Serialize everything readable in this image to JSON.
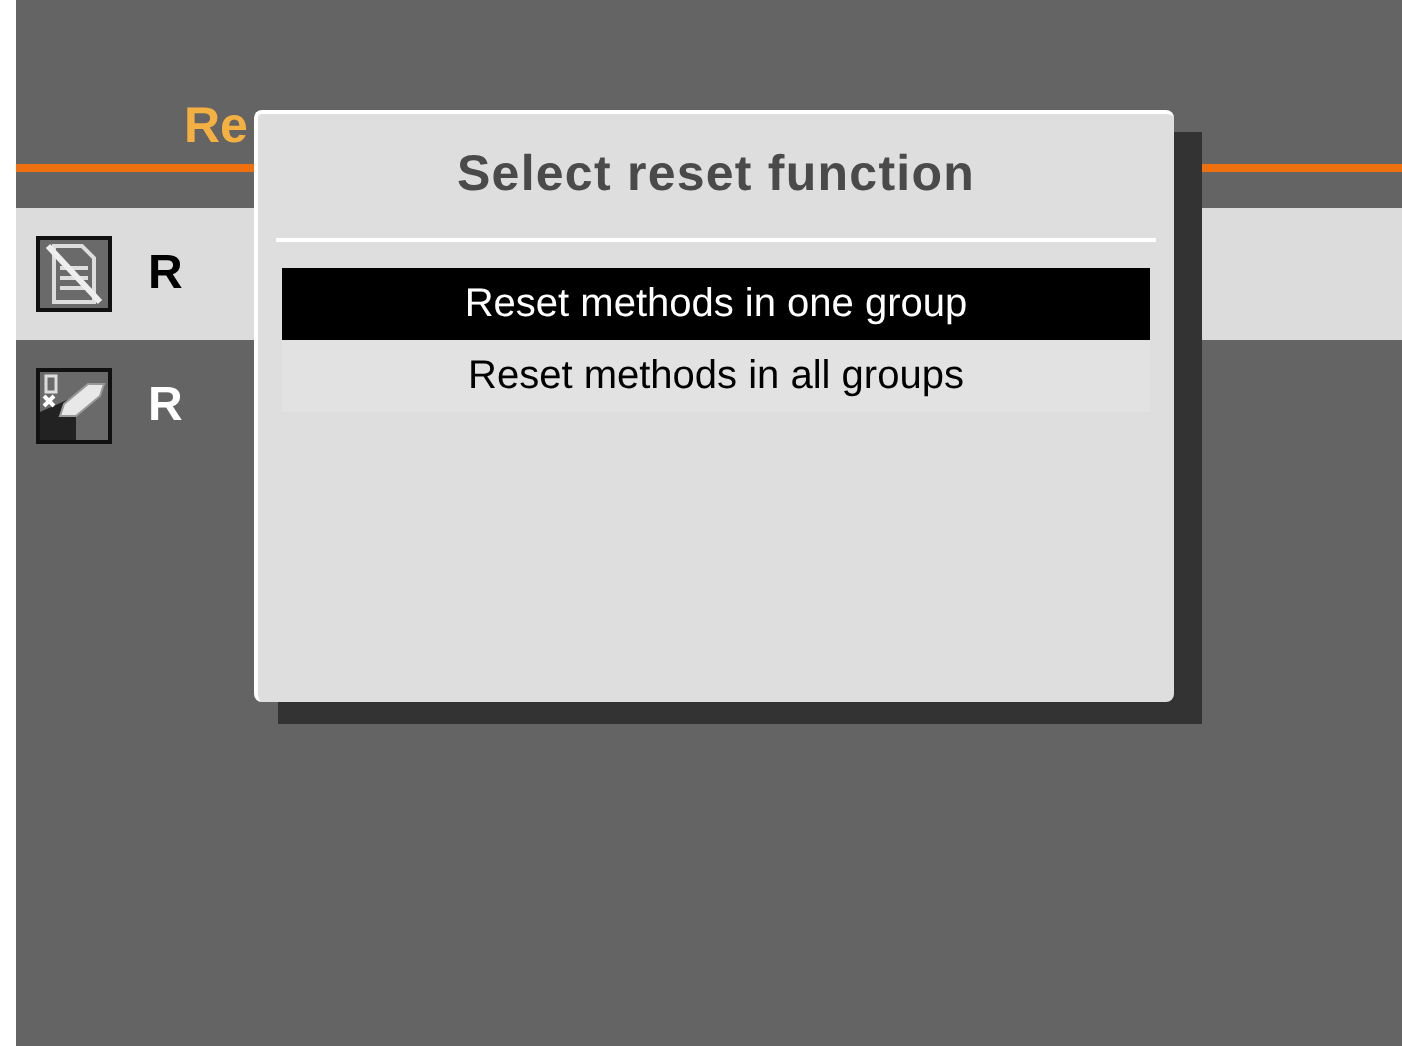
{
  "screen": {
    "title": "Re",
    "items": [
      {
        "label": "R",
        "kind": "document",
        "selected": true
      },
      {
        "label": "R",
        "kind": "eraser",
        "selected": false
      }
    ]
  },
  "dialog": {
    "title": "Select reset function",
    "options": [
      {
        "label": "Reset methods in one group",
        "selected": true
      },
      {
        "label": "Reset methods in all groups",
        "selected": false
      }
    ]
  }
}
